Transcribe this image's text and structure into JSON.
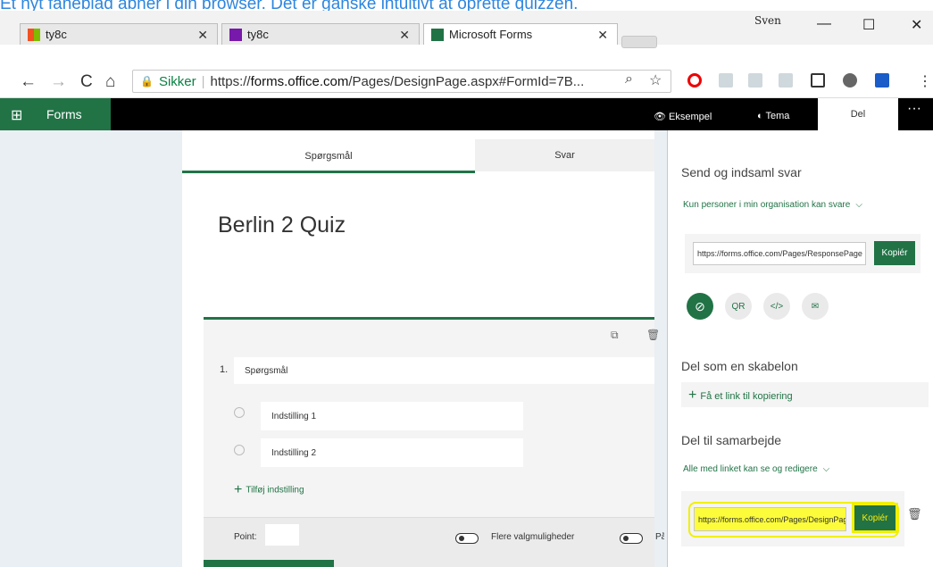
{
  "caption": "Et nyt faneblad åbner i din browser. Det er ganske intuitivt at oprette quizzen.",
  "window": {
    "user": "Sven",
    "minimize": "—",
    "maximize": "☐",
    "close": "✕"
  },
  "tabs": [
    {
      "label": "ty8c",
      "close": "✕"
    },
    {
      "label": "ty8c",
      "close": "✕"
    },
    {
      "label": "Microsoft Forms",
      "close": "✕"
    }
  ],
  "nav": {
    "back": "←",
    "forward": "→",
    "reload": "C",
    "home": "⌂"
  },
  "address": {
    "lock": "🔒",
    "secure": "Sikker",
    "sep": "|",
    "url_prefix": "https://",
    "url_domain": "forms.office.com",
    "url_rest": "/Pages/DesignPage.aspx#FormId=7B..."
  },
  "appbar": {
    "brand": "Forms",
    "preview": "Eksempel",
    "theme": "Tema",
    "share": "Del",
    "more": "···"
  },
  "form": {
    "tab_questions": "Spørgsmål",
    "tab_responses": "Svar",
    "title": "Berlin 2 Quiz",
    "question_number": "1.",
    "question_placeholder": "Spørgsmål",
    "option1": "Indstilling 1",
    "option2": "Indstilling 2",
    "add_option": "Tilføj indstilling",
    "points_label": "Point:",
    "multiple_answers": "Flere valgmuligheder",
    "required_prefix": "På"
  },
  "panel": {
    "send_header": "Send og indsaml svar",
    "org_only": "Kun personer i min organisation kan svare",
    "response_url": "https://forms.office.com/Pages/ResponsePage",
    "copy": "Kopiér",
    "qr": "QR",
    "embed": "</>",
    "template_header": "Del som en skabelon",
    "template_link": "Få et link til kopiering",
    "collab_header": "Del til samarbejde",
    "collab_scope": "Alle med linket kan se og redigere",
    "collab_url": "https://forms.office.com/Pages/DesignPage",
    "collab_copy": "Kopiér"
  }
}
